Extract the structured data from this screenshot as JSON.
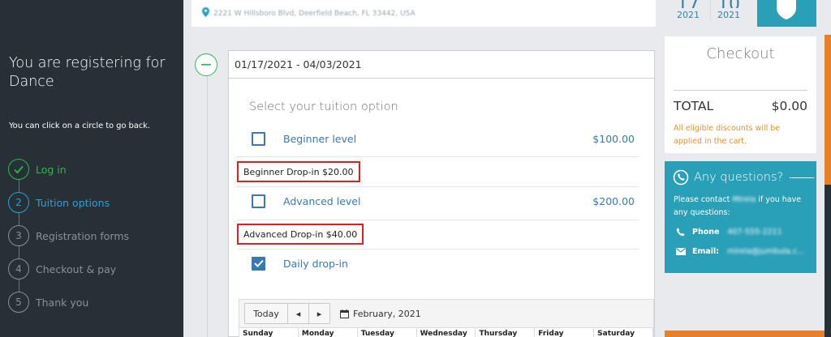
{
  "sidebar": {
    "intro": "You are registering for Dance",
    "hint": "You can click on a circle to go back.",
    "steps": [
      {
        "num": "",
        "label": "Log in",
        "state": "done"
      },
      {
        "num": "2",
        "label": "Tuition options",
        "state": "active"
      },
      {
        "num": "3",
        "label": "Registration forms",
        "state": "pending"
      },
      {
        "num": "4",
        "label": "Checkout & pay",
        "state": "pending"
      },
      {
        "num": "5",
        "label": "Thank you",
        "state": "pending"
      }
    ]
  },
  "header": {
    "address": "2221 W Hillsboro Blvd, Deerfield Beach, FL 33442, USA",
    "start": {
      "day": "17",
      "year": "2021"
    },
    "end": {
      "day": "10",
      "year": "2021"
    }
  },
  "session": {
    "date_range": "01/17/2021 - 04/03/2021",
    "select_title": "Select your tuition option",
    "options": [
      {
        "name": "Beginner level",
        "price": "$100.00",
        "checked": false
      },
      {
        "name": "Advanced level",
        "price": "$200.00",
        "checked": false
      },
      {
        "name": "Daily drop-in",
        "price": "",
        "checked": true
      }
    ],
    "dropins": [
      "Beginner Drop-in $20.00",
      "Advanced Drop-in $40.00"
    ]
  },
  "calendar": {
    "today_label": "Today",
    "prev": "◂",
    "next": "▸",
    "month": "February, 2021",
    "weekdays": [
      "Sunday",
      "Monday",
      "Tuesday",
      "Wednesday",
      "Thursday",
      "Friday",
      "Saturday"
    ]
  },
  "checkout": {
    "title": "Checkout",
    "total_label": "TOTAL",
    "total_value": "$0.00",
    "note": "All eligible discounts will be applied in the cart."
  },
  "questions": {
    "title": "Any questions?",
    "text_before": "Please contact",
    "contact_name": "Mirela",
    "text_after": "if you have any questions:",
    "phone_label": "Phone",
    "phone_value": "407-555-2211",
    "email_label": "Email:",
    "email_value": "mirela@jumbula.c..."
  },
  "colors": {
    "sidebar_bg": "#263036",
    "done_green": "#2fb84e",
    "active_blue": "#2ba2d6",
    "link_blue": "#3a78b4",
    "teal": "#2a9fb8",
    "orange": "#e8912a",
    "highlight_red": "#e02020"
  },
  "icons": [
    "check-icon",
    "map-pin-icon",
    "minus-icon",
    "shield-icon",
    "calendar-icon",
    "phone-icon",
    "email-icon",
    "chat-phone-icon"
  ]
}
